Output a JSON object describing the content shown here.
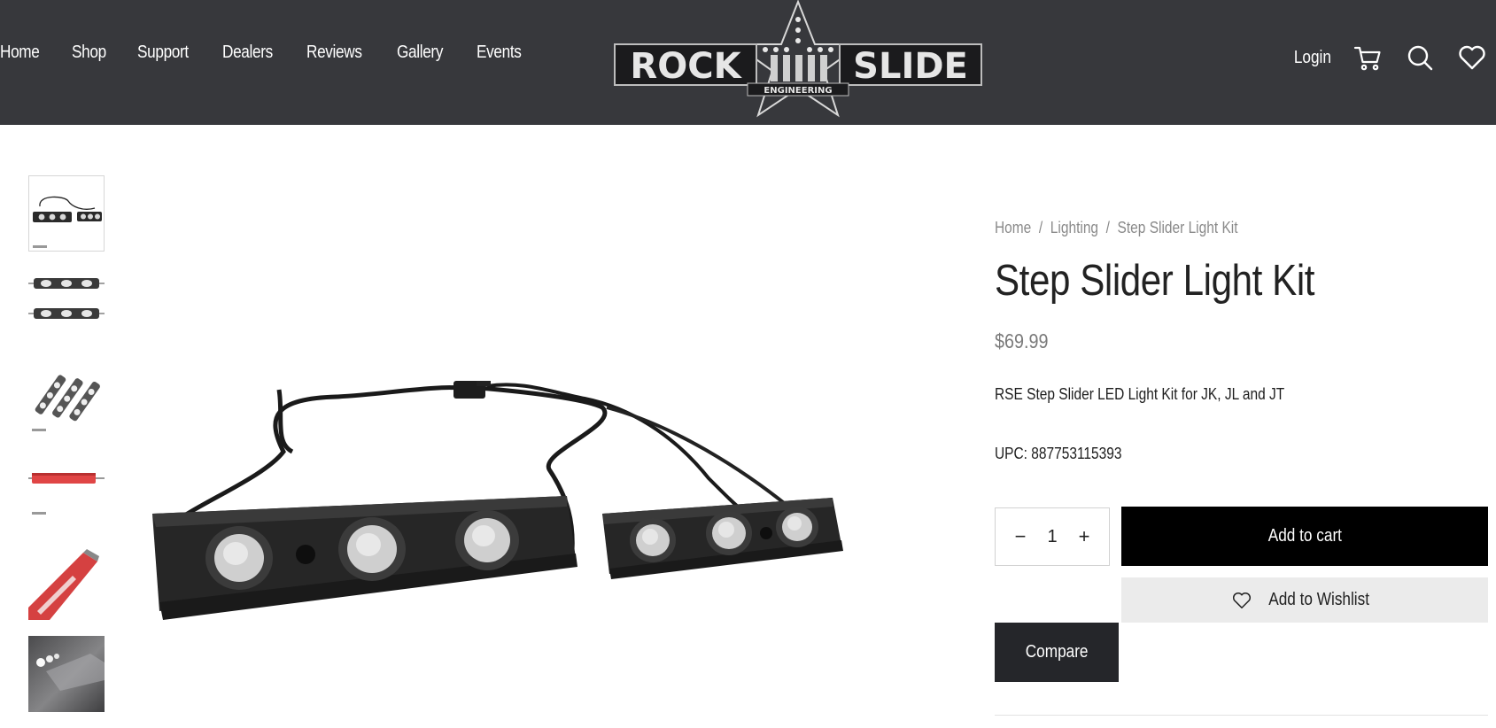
{
  "nav": {
    "items": [
      "Home",
      "Shop",
      "Support",
      "Dealers",
      "Reviews",
      "Gallery",
      "Events"
    ]
  },
  "logo": {
    "left_text": "ROCK",
    "right_text": "SLIDE",
    "sub_text": "ENGINEERING"
  },
  "header_right": {
    "login": "Login",
    "icons": [
      "cart-icon",
      "search-icon",
      "heart-icon"
    ]
  },
  "breadcrumb": {
    "items": [
      "Home",
      "Lighting",
      "Step Slider Light Kit"
    ],
    "separator": "/"
  },
  "product": {
    "title": "Step Slider Light Kit",
    "price": "$69.99",
    "description": "RSE Step Slider LED Light Kit for JK, JL and JT",
    "upc": "UPC: 887753115393"
  },
  "quantity": {
    "value": "1",
    "minus": "−",
    "plus": "+"
  },
  "actions": {
    "add_to_cart": "Add to cart",
    "add_to_wishlist": "Add to Wishlist",
    "compare": "Compare"
  },
  "colors": {
    "header_bg": "#37383c",
    "primary_button": "#000000",
    "compare_button": "#25262a",
    "wishlist_bg": "#ebebeb",
    "muted_text": "#8a8a8a"
  }
}
